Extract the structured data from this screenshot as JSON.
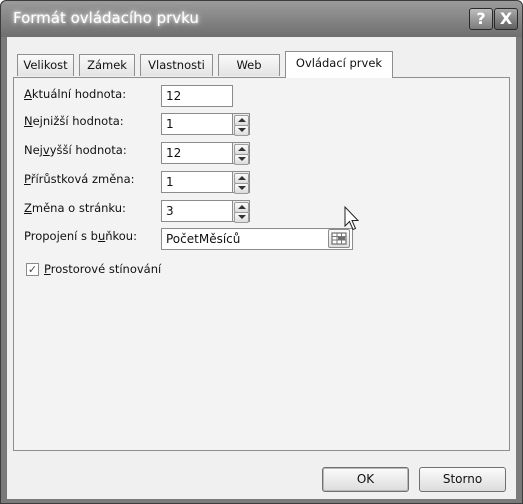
{
  "window": {
    "title": "Formát ovládacího prvku",
    "help_glyph": "?",
    "close_glyph": "X"
  },
  "tabs": [
    {
      "label": "Velikost",
      "active": false
    },
    {
      "label": "Zámek",
      "active": false
    },
    {
      "label": "Vlastnosti",
      "active": false
    },
    {
      "label": "Web",
      "active": false
    },
    {
      "label": "Ovládací prvek",
      "active": true
    }
  ],
  "form": {
    "current_value": {
      "pre": "",
      "key": "A",
      "post": "ktuální hodnota:",
      "value": "12"
    },
    "min_value": {
      "pre": "",
      "key": "N",
      "post": "ejnižší hodnota:",
      "value": "1"
    },
    "max_value": {
      "pre": "Nej",
      "key": "v",
      "post": "yšší hodnota:",
      "value": "12"
    },
    "increment": {
      "pre": "",
      "key": "P",
      "post": "řírůstková změna:",
      "value": "1"
    },
    "page_change": {
      "pre": "",
      "key": "Z",
      "post": "měna o stránku:",
      "value": "3"
    },
    "cell_link": {
      "pre": "Propojení s b",
      "key": "u",
      "post": "ňkou:",
      "value": "PočetMěsíců"
    },
    "shading": {
      "pre": "",
      "key": "P",
      "post": "rostorové stínování",
      "checked": true,
      "check_glyph": "✓"
    }
  },
  "buttons": {
    "ok": "OK",
    "cancel": "Storno"
  },
  "icons": {
    "spinner": "spinner-arrows-icon",
    "cell_ref": "collapse-dialog-icon",
    "cursor": "mouse-pointer-icon"
  }
}
